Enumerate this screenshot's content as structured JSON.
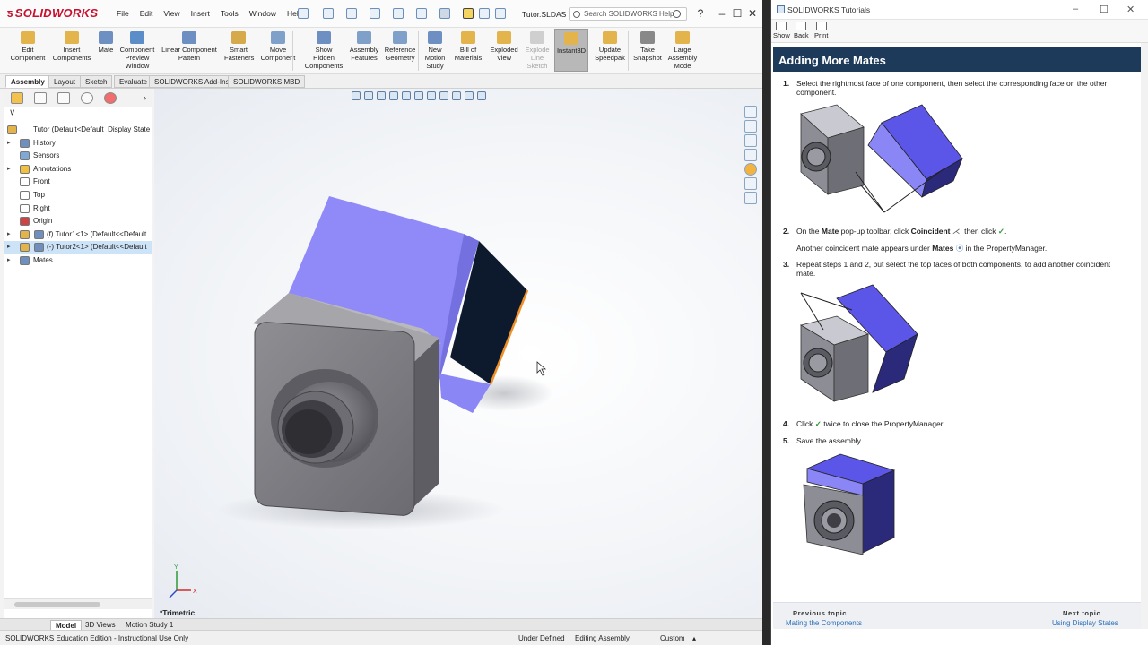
{
  "sw": {
    "app_name": "SOLIDWORKS",
    "menu": [
      "File",
      "Edit",
      "View",
      "Insert",
      "Tools",
      "Window",
      "Help"
    ],
    "file_name": "Tutor.SLDAS",
    "search_placeholder": "Search SOLIDWORKS Help",
    "commands": [
      {
        "label": "Edit\nComponent",
        "state": "normal"
      },
      {
        "label": "Insert\nComponents",
        "state": "normal"
      },
      {
        "label": "Mate",
        "state": "normal"
      },
      {
        "label": "Component\nPreview\nWindow",
        "state": "normal"
      },
      {
        "label": "Linear Component\nPattern",
        "state": "normal"
      },
      {
        "label": "Smart\nFasteners",
        "state": "normal"
      },
      {
        "label": "Move\nComponent",
        "state": "normal"
      },
      {
        "label": "Show\nHidden\nComponents",
        "state": "normal"
      },
      {
        "label": "Assembly\nFeatures",
        "state": "normal"
      },
      {
        "label": "Reference\nGeometry",
        "state": "normal"
      },
      {
        "label": "New\nMotion\nStudy",
        "state": "normal"
      },
      {
        "label": "Bill of\nMaterials",
        "state": "normal"
      },
      {
        "label": "Exploded\nView",
        "state": "normal"
      },
      {
        "label": "Explode\nLine\nSketch",
        "state": "disabled"
      },
      {
        "label": "Instant3D",
        "state": "active"
      },
      {
        "label": "Update\nSpeedpak",
        "state": "normal"
      },
      {
        "label": "Take\nSnapshot",
        "state": "normal"
      },
      {
        "label": "Large\nAssembly\nMode",
        "state": "normal"
      }
    ],
    "tabs": [
      "Assembly",
      "Layout",
      "Sketch",
      "Evaluate",
      "SOLIDWORKS Add-Ins",
      "SOLIDWORKS MBD"
    ],
    "active_tab": "Assembly",
    "tree": [
      {
        "label": "Tutor  (Default<Default_Display State",
        "indent": 0,
        "icon": "assembly-icon",
        "exp": ""
      },
      {
        "label": "History",
        "indent": 1,
        "icon": "history-icon",
        "exp": "▸"
      },
      {
        "label": "Sensors",
        "indent": 1,
        "icon": "sensors-icon",
        "exp": ""
      },
      {
        "label": "Annotations",
        "indent": 1,
        "icon": "annotations-icon",
        "exp": "▸"
      },
      {
        "label": "Front",
        "indent": 1,
        "icon": "plane-icon",
        "exp": ""
      },
      {
        "label": "Top",
        "indent": 1,
        "icon": "plane-icon",
        "exp": ""
      },
      {
        "label": "Right",
        "indent": 1,
        "icon": "plane-icon",
        "exp": ""
      },
      {
        "label": "Origin",
        "indent": 1,
        "icon": "origin-icon",
        "exp": ""
      },
      {
        "label": "(f) Tutor1<1> (Default<<Default",
        "indent": 1,
        "icon": "part-icon",
        "exp": "▸"
      },
      {
        "label": "(-) Tutor2<1> (Default<<Default",
        "indent": 1,
        "icon": "part-icon",
        "exp": "▸",
        "selected": true
      },
      {
        "label": "Mates",
        "indent": 1,
        "icon": "mates-icon",
        "exp": "▸"
      }
    ],
    "view_label": "*Trimetric",
    "bottom_tabs": [
      "Model",
      "3D Views",
      "Motion Study 1"
    ],
    "status": {
      "edition": "SOLIDWORKS Education Edition - Instructional Use Only",
      "state": "Under Defined",
      "mode": "Editing Assembly",
      "units": "Custom"
    }
  },
  "tutorial": {
    "window_title": "SOLIDWORKS Tutorials",
    "toolbar": [
      "Show",
      "Back",
      "Print"
    ],
    "header": "Adding More Mates",
    "steps": [
      {
        "num": "1.",
        "text": "Select the rightmost face of one component, then select the corresponding face on the other component."
      },
      {
        "num": "2.",
        "text_a": "On the ",
        "bold_a": "Mate",
        "text_b": " pop-up toolbar, click ",
        "bold_b": "Coincident",
        "text_c": ", then click",
        "sub_a": "Another coincident mate appears under ",
        "sub_bold": "Mates",
        "sub_b": " in the PropertyManager."
      },
      {
        "num": "3.",
        "text": "Repeat steps 1 and 2, but select the top faces of both components, to add another coincident mate."
      },
      {
        "num": "4.",
        "text_a": "Click",
        "text_b": " twice to close the PropertyManager."
      },
      {
        "num": "5.",
        "text": "Save the assembly."
      }
    ],
    "footer": {
      "prev_label": "Previous topic",
      "prev_link": "Mating the Components",
      "next_label": "Next topic",
      "next_link": "Using Display States"
    }
  },
  "colors": {
    "part_blue": "#8a86f5",
    "part_gray": "#8a8a90",
    "header_bg": "#1e3a5a",
    "link": "#2a6fb8"
  }
}
